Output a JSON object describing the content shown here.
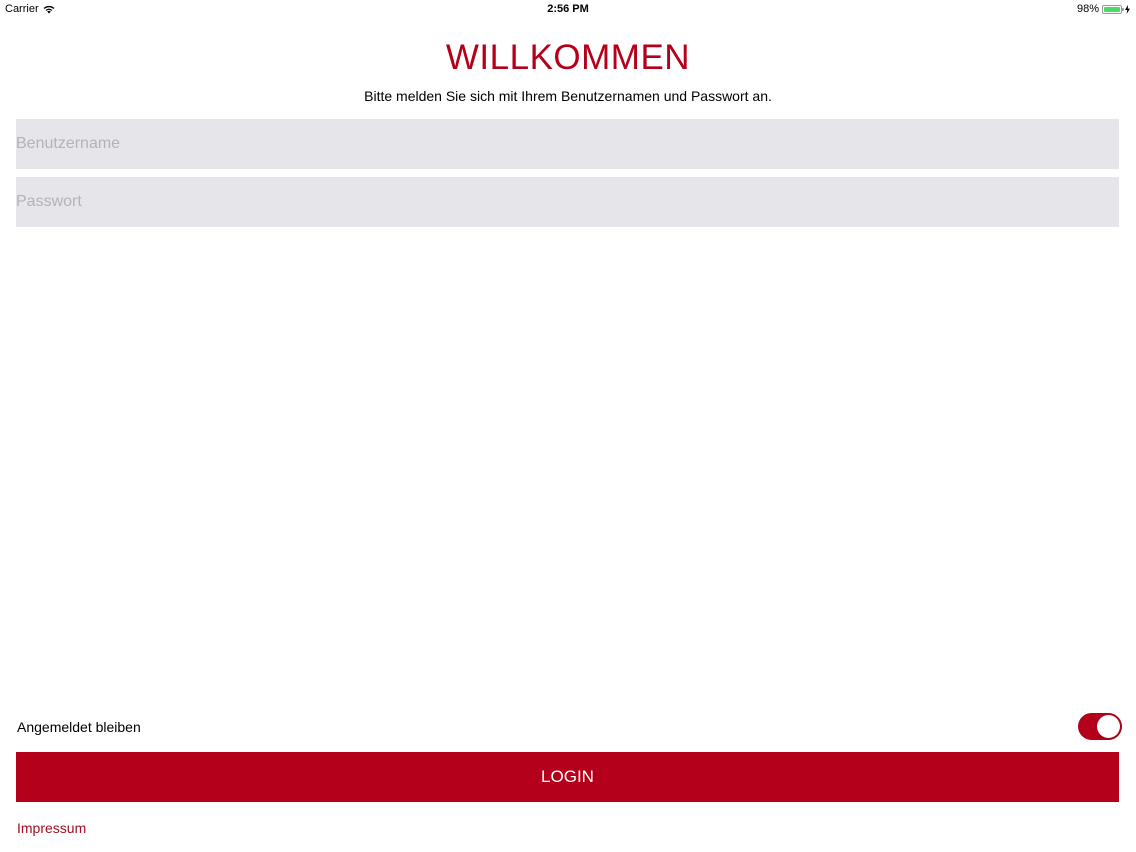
{
  "status_bar": {
    "carrier": "Carrier",
    "time": "2:56 PM",
    "battery_percent_text": "98%",
    "battery_level": 0.98,
    "battery_color": "#4cd964",
    "icons": [
      "wifi-icon",
      "battery-icon",
      "charging-bolt-icon"
    ]
  },
  "login": {
    "title": "WILLKOMMEN",
    "subtitle": "Bitte melden Sie sich mit Ihrem Benutzernamen und Passwort an.",
    "username": {
      "placeholder": "Benutzername",
      "value": ""
    },
    "password": {
      "placeholder": "Passwort",
      "value": ""
    },
    "stay_logged_in": {
      "label": "Angemeldet bleiben",
      "on": true
    },
    "login_button": "LOGIN",
    "impressum_link": "Impressum"
  },
  "colors": {
    "accent": "#b5001b",
    "field_background": "#e6e5e9",
    "link": "#a20d23"
  }
}
